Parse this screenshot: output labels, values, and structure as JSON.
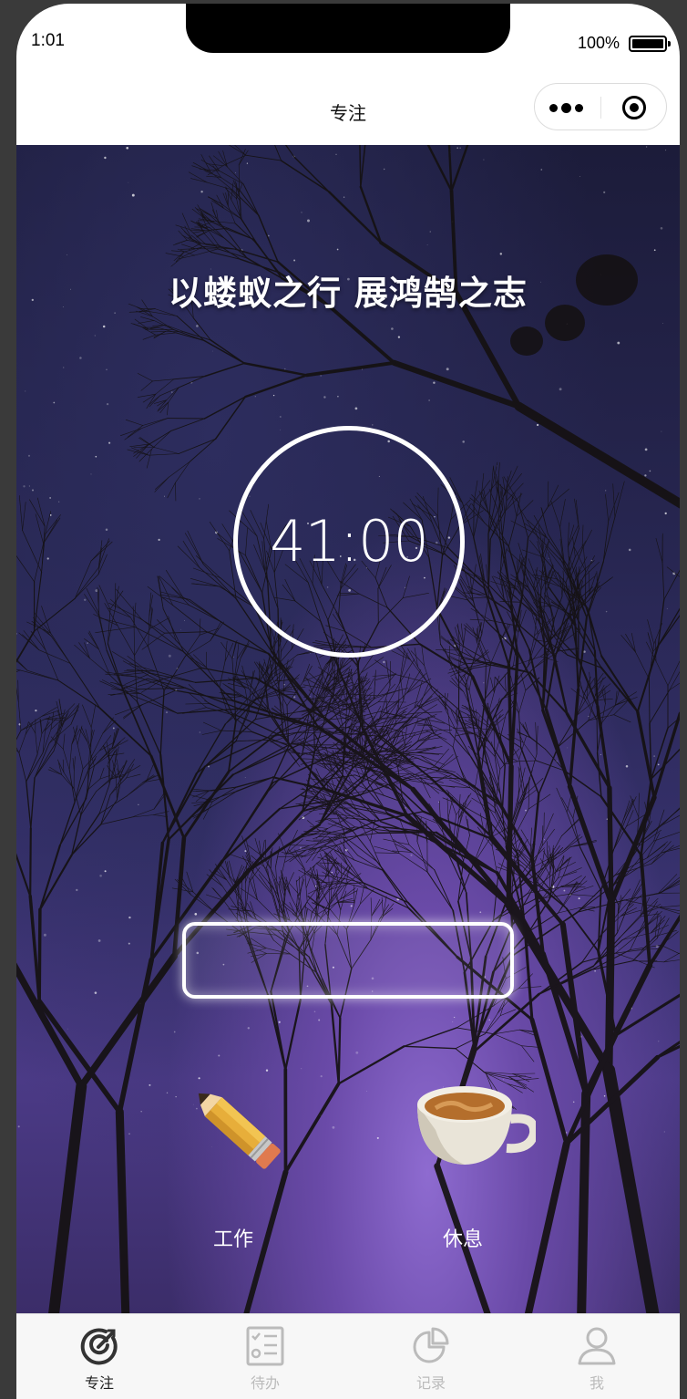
{
  "status_bar": {
    "time": "1:01",
    "battery": "100%"
  },
  "nav": {
    "title": "专注",
    "capsule_more_icon": "more-dots-icon",
    "capsule_close_icon": "target-icon"
  },
  "main": {
    "motto": "以蝼蚁之行 展鸿鹄之志",
    "timer": "41:00",
    "task_input": {
      "value": "",
      "placeholder": ""
    },
    "modes": [
      {
        "label": "工作",
        "icon": "pencil-icon"
      },
      {
        "label": "休息",
        "icon": "coffee-cup-icon"
      }
    ]
  },
  "tabbar": {
    "items": [
      {
        "label": "专注",
        "icon": "focus-icon",
        "active": true
      },
      {
        "label": "待办",
        "icon": "checklist-icon",
        "active": false
      },
      {
        "label": "记录",
        "icon": "pie-chart-icon",
        "active": false
      },
      {
        "label": "我",
        "icon": "user-icon",
        "active": false
      }
    ]
  },
  "colors": {
    "active_tab": "#222222",
    "inactive_tab": "#bbbbbb",
    "tabbar_bg": "#f7f7f7"
  }
}
